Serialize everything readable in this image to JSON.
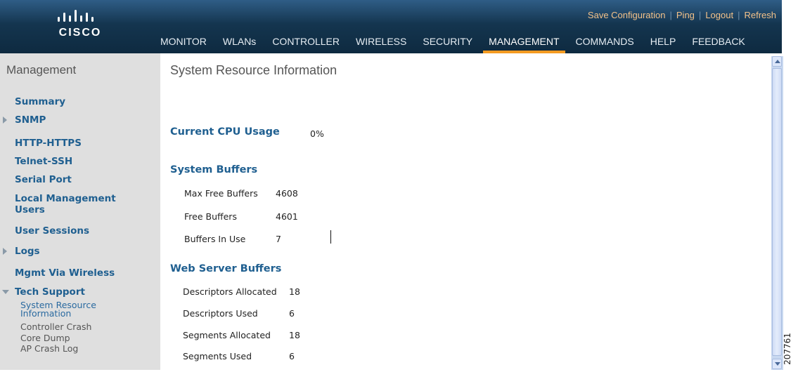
{
  "brand": {
    "logo_text": "CISCO"
  },
  "top_links": [
    {
      "label": "Save Configuration"
    },
    {
      "label": "Ping"
    },
    {
      "label": "Logout"
    },
    {
      "label": "Refresh"
    }
  ],
  "menu": [
    {
      "label": "MONITOR"
    },
    {
      "label": "WLANs"
    },
    {
      "label": "CONTROLLER"
    },
    {
      "label": "WIRELESS"
    },
    {
      "label": "SECURITY"
    },
    {
      "label": "MANAGEMENT",
      "active": true
    },
    {
      "label": "COMMANDS"
    },
    {
      "label": "HELP"
    },
    {
      "label": "FEEDBACK"
    }
  ],
  "sidebar": {
    "title": "Management",
    "items": [
      {
        "label": "Summary"
      },
      {
        "label": "SNMP"
      },
      {
        "label": "HTTP-HTTPS"
      },
      {
        "label": "Telnet-SSH"
      },
      {
        "label": "Serial Port"
      },
      {
        "label_line1": "Local Management",
        "label_line2": "Users"
      },
      {
        "label": "User Sessions"
      },
      {
        "label": "Logs"
      },
      {
        "label": "Mgmt Via Wireless"
      },
      {
        "label": "Tech Support"
      }
    ],
    "sub_items": [
      {
        "label_line1": "System Resource",
        "label_line2": "Information"
      },
      {
        "label": "Controller Crash"
      },
      {
        "label": "Core Dump"
      },
      {
        "label": "AP Crash Log"
      }
    ]
  },
  "main": {
    "title": "System Resource Information",
    "cpu": {
      "label": "Current CPU Usage",
      "value": "0%"
    },
    "system_buffers": {
      "heading": "System Buffers",
      "rows": [
        {
          "label": "Max Free Buffers",
          "value": "4608"
        },
        {
          "label": "Free Buffers",
          "value": "4601"
        },
        {
          "label": "Buffers In Use",
          "value": "7"
        }
      ]
    },
    "web_server_buffers": {
      "heading": "Web Server Buffers",
      "rows": [
        {
          "label": "Descriptors Allocated",
          "value": "18"
        },
        {
          "label": "Descriptors Used",
          "value": "6"
        },
        {
          "label": "Segments Allocated",
          "value": "18"
        },
        {
          "label": "Segments Used",
          "value": "6"
        }
      ]
    }
  },
  "figure_ref": "207761",
  "colors": {
    "banner": "#14354f",
    "active_tab_underline": "#f49b22",
    "nav_link": "#1f5f90",
    "top_link": "#f3c28a"
  }
}
